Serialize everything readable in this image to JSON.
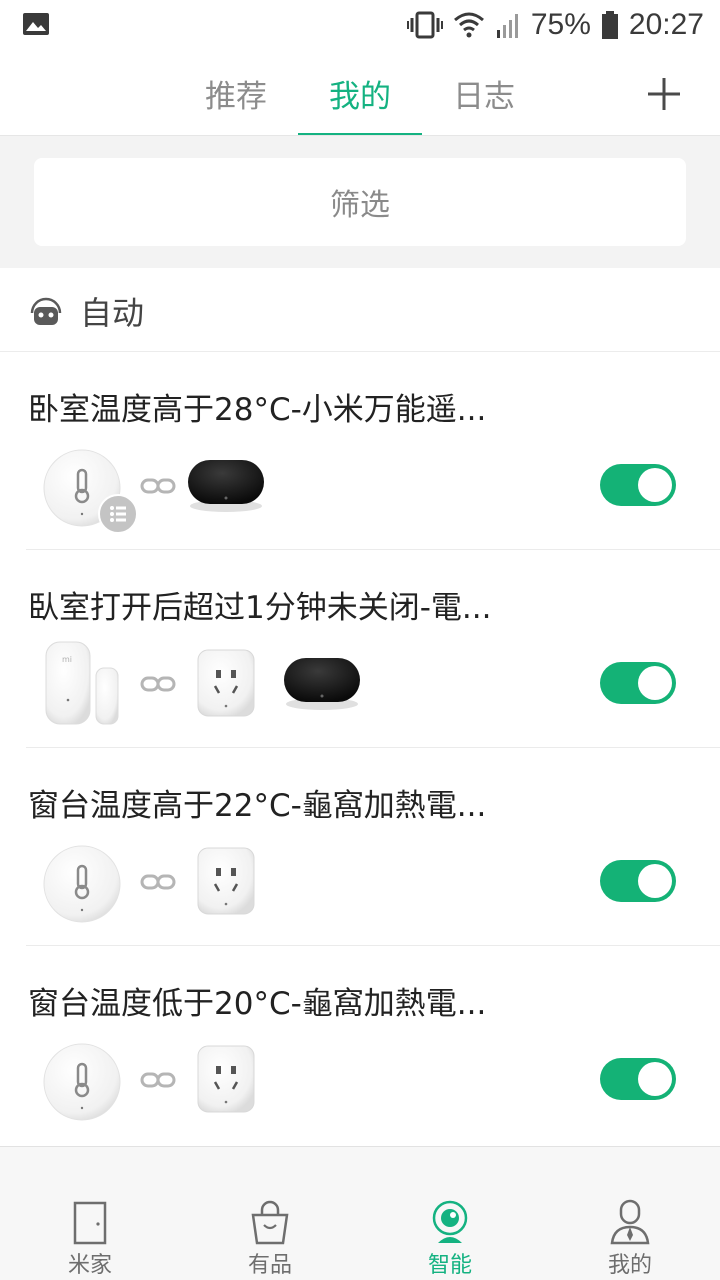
{
  "status_bar": {
    "battery": "75%",
    "time": "20:27"
  },
  "tabs": [
    {
      "label": "推荐",
      "active": false
    },
    {
      "label": "我的",
      "active": true
    },
    {
      "label": "日志",
      "active": false
    }
  ],
  "filter": {
    "label": "筛选"
  },
  "section": {
    "title": "自动"
  },
  "automations": [
    {
      "title": "卧室温度高于28°C-小米万能遥...",
      "enabled": true
    },
    {
      "title": "臥室打开后超过1分钟未关闭-電...",
      "enabled": true
    },
    {
      "title": "窗台温度高于22°C-龜窩加熱電...",
      "enabled": true
    },
    {
      "title": "窗台温度低于20°C-龜窩加熱電...",
      "enabled": true
    }
  ],
  "bottom_nav": [
    {
      "label": "米家",
      "icon": "door-icon",
      "active": false
    },
    {
      "label": "有品",
      "icon": "shopping-bag-icon",
      "active": false
    },
    {
      "label": "智能",
      "icon": "smart-camera-icon",
      "active": true
    },
    {
      "label": "我的",
      "icon": "person-icon",
      "active": false
    }
  ],
  "colors": {
    "accent": "#14b281",
    "toggle_on": "#14b276"
  }
}
